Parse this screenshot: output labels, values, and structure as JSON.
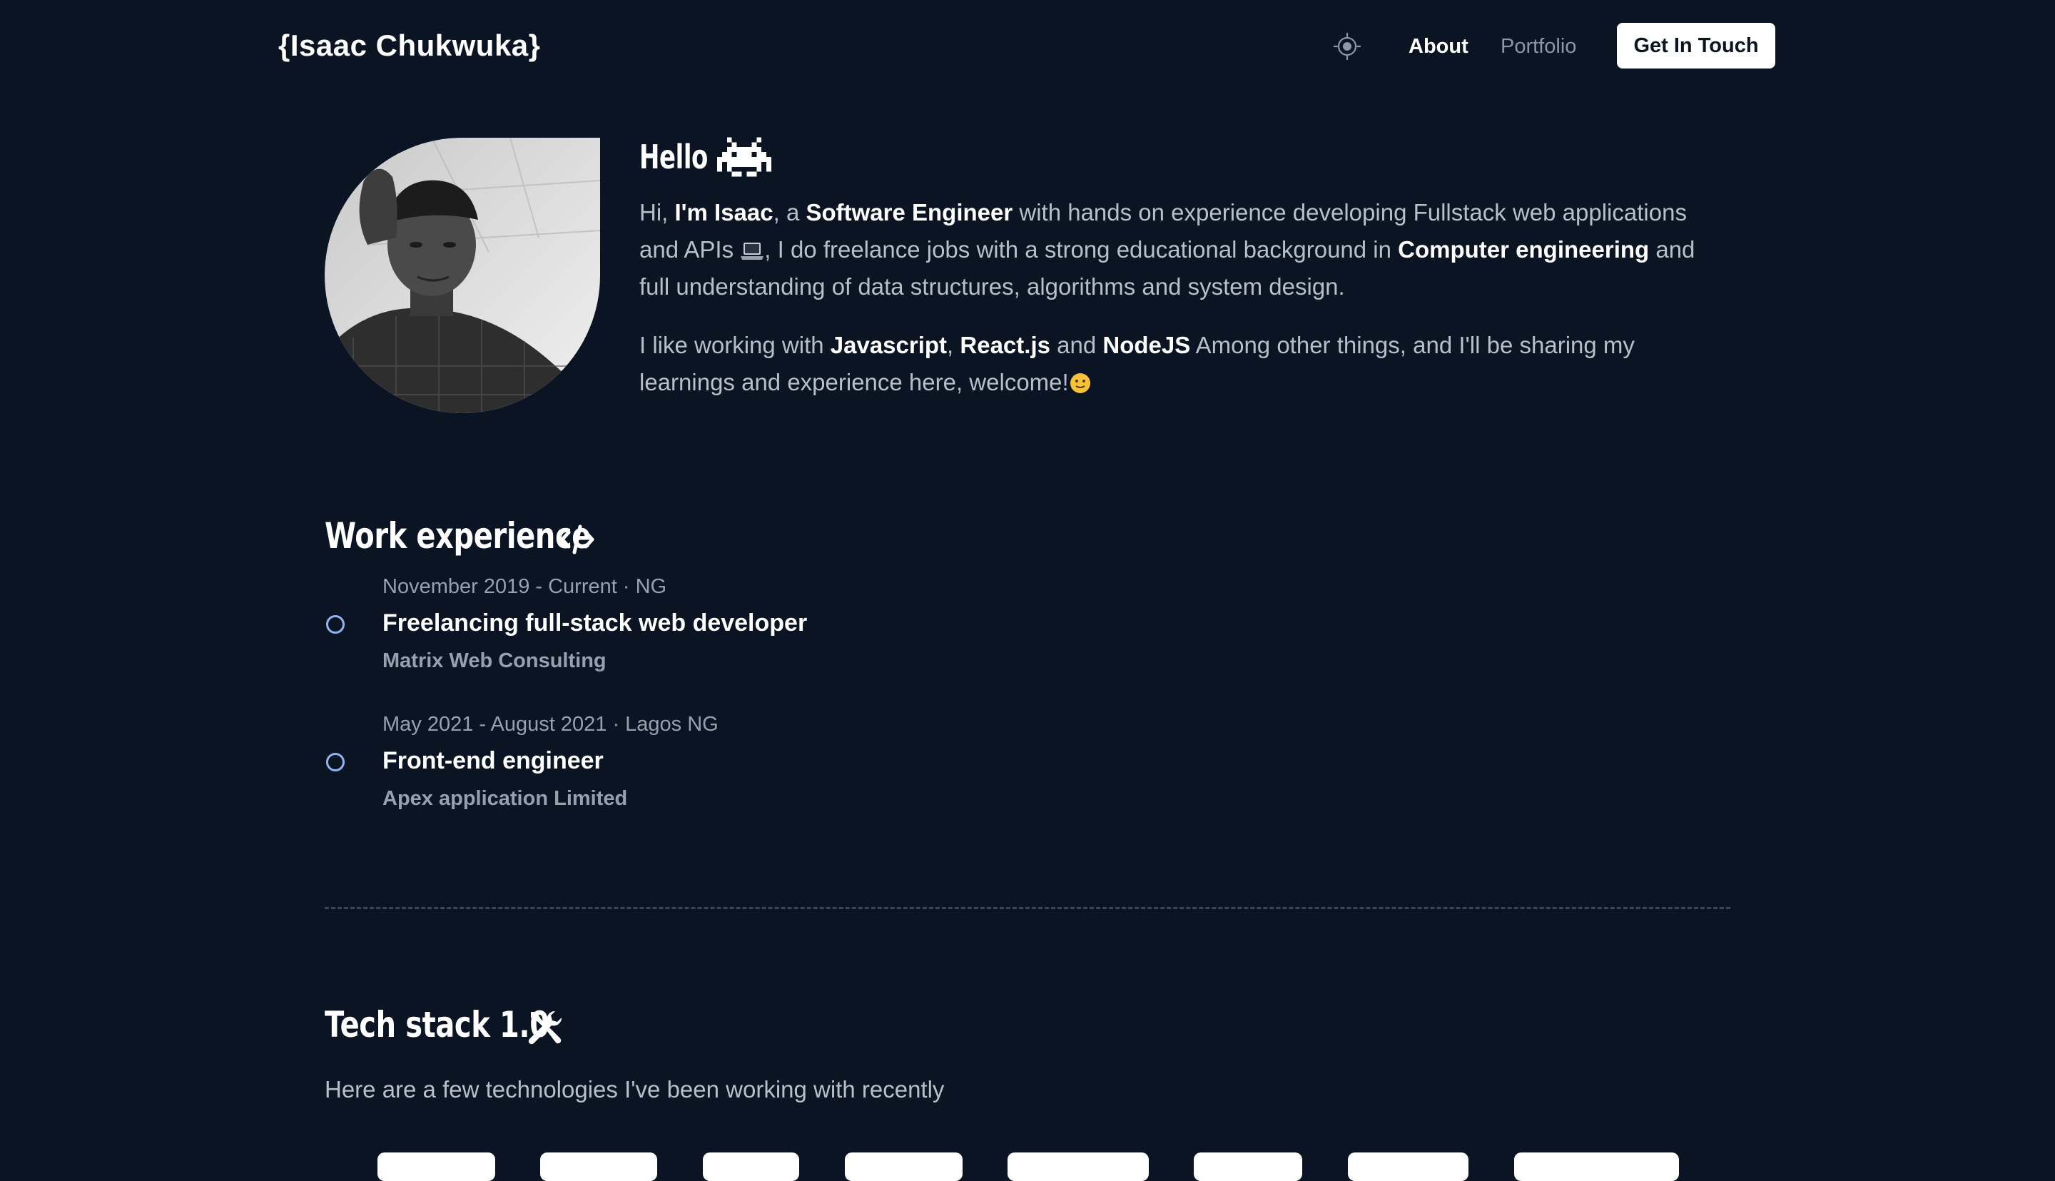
{
  "header": {
    "brand": "{Isaac Chukwuka}",
    "theme_toggle_icon": "sun-icon",
    "nav": [
      {
        "label": "About",
        "active": true
      },
      {
        "label": "Portfolio",
        "active": false
      }
    ],
    "cta_label": "Get In Touch"
  },
  "intro": {
    "heading": "Hello",
    "heading_icon": "space-invader-icon",
    "p1": {
      "t1": "Hi, ",
      "b1": "I'm Isaac",
      "t2": ", a ",
      "b2": "Software Engineer",
      "t3": " with hands on experience developing Fullstack web applications and APIs ",
      "t4": ", I do freelance jobs with a strong educational background in ",
      "b3": "Computer engineering",
      "t5": " and full understanding of data structures, algorithms and system design."
    },
    "p2": {
      "t1": "I like working with ",
      "b1": "Javascript",
      "t2": ", ",
      "b2": "React.js",
      "t3": " and ",
      "b3": "NodeJS",
      "t4": " Among other things, and I'll be sharing my learnings and experience here, welcome!"
    }
  },
  "work": {
    "title": "Work experience",
    "title_icon": "code-icon",
    "jobs": [
      {
        "meta": "November 2019 - Current · NG",
        "role": "Freelancing full-stack web developer",
        "company": "Matrix Web Consulting"
      },
      {
        "meta": "May 2021 - August 2021 · Lagos NG",
        "role": "Front-end engineer",
        "company": "Apex application Limited"
      }
    ]
  },
  "tech": {
    "title": "Tech stack 1.0",
    "title_icon": "tools-icon",
    "subtitle": "Here are a few technologies I've been working with recently"
  },
  "colors": {
    "background": "#0a1422",
    "accent_dot": "#93b4f0",
    "muted_text": "#b6bfcb",
    "cta_bg": "#ffffff"
  }
}
